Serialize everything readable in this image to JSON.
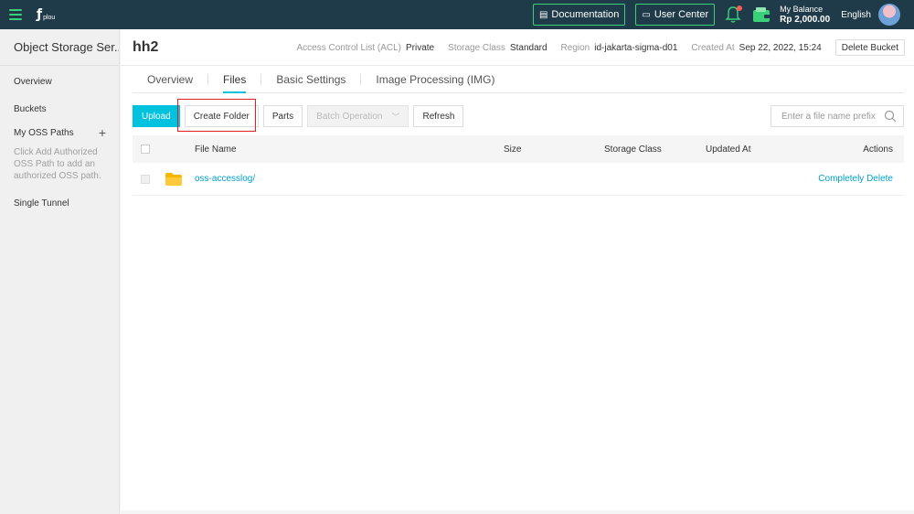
{
  "topbar": {
    "logo_text": "plou",
    "documentation": "Documentation",
    "user_center": "User Center",
    "balance_label": "My Balance",
    "balance_amount": "Rp 2,000.00",
    "language": "English"
  },
  "sidebar": {
    "title": "Object Storage Ser...",
    "overview": "Overview",
    "buckets": "Buckets",
    "my_oss_paths": "My OSS Paths",
    "add_symbol": "+",
    "hint": "Click Add Authorized OSS Path to add an authorized OSS path.",
    "single_tunnel": "Single Tunnel"
  },
  "header": {
    "bucket_name": "hh2",
    "acl_label": "Access Control List (ACL)",
    "acl_value": "Private",
    "storage_class_label": "Storage Class",
    "storage_class_value": "Standard",
    "region_label": "Region",
    "region_value": "id-jakarta-sigma-d01",
    "created_label": "Created At",
    "created_value": "Sep 22, 2022, 15:24",
    "delete_bucket": "Delete Bucket"
  },
  "tabs": [
    {
      "label": "Overview"
    },
    {
      "label": "Files"
    },
    {
      "label": "Basic Settings"
    },
    {
      "label": "Image Processing (IMG)"
    }
  ],
  "toolbar": {
    "upload": "Upload",
    "create_folder": "Create Folder",
    "parts": "Parts",
    "batch_operation": "Batch Operation",
    "refresh": "Refresh",
    "search_placeholder": "Enter a file name prefix"
  },
  "table": {
    "columns": {
      "name": "File Name",
      "size": "Size",
      "storage_class": "Storage Class",
      "updated_at": "Updated At",
      "actions": "Actions"
    },
    "rows": [
      {
        "name": "oss-accesslog/",
        "size": "",
        "storage_class": "",
        "updated_at": "",
        "action": "Completely Delete"
      }
    ]
  },
  "colors": {
    "topbar": "#1f3a48",
    "accent": "#00c1de",
    "green": "#3ad07a",
    "highlight": "#e02020"
  }
}
